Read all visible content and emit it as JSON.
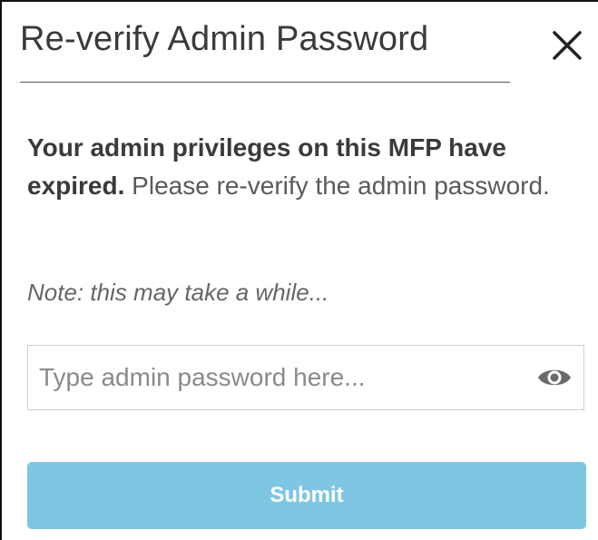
{
  "dialog": {
    "title": "Re-verify Admin Password",
    "close_icon": "close-icon",
    "message_strong": "Your admin privileges on this MFP have expired.",
    "message_rest": " Please re-verify the admin password.",
    "note": "Note: this may take a while...",
    "password_field": {
      "value": "",
      "placeholder": "Type admin password here...",
      "visibility_icon": "eye-icon"
    },
    "submit_label": "Submit"
  },
  "colors": {
    "submit_bg": "#7fc6e2",
    "text_primary": "#3a3a3a",
    "text_secondary": "#5a5a5a",
    "border": "#cfcfcf"
  }
}
